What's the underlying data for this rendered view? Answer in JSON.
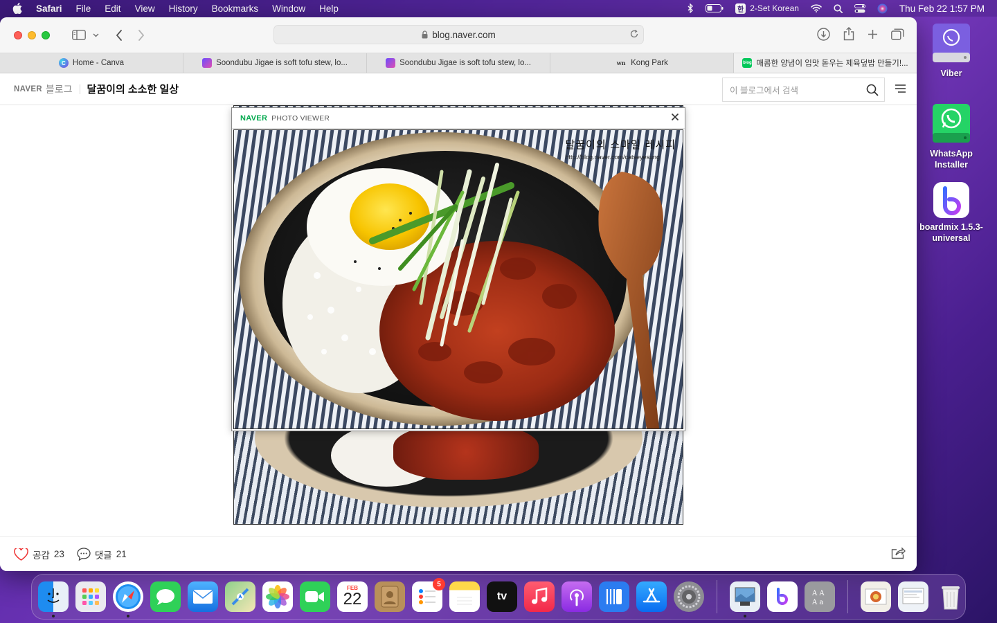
{
  "menubar": {
    "app_name": "Safari",
    "menus": [
      "File",
      "Edit",
      "View",
      "History",
      "Bookmarks",
      "Window",
      "Help"
    ],
    "input_source": "2-Set Korean",
    "input_glyph": "한",
    "datetime": "Thu Feb 22  1:57 PM"
  },
  "browser": {
    "url": "blog.naver.com",
    "tabs": [
      {
        "title": "Home - Canva",
        "icon": "canva-icon"
      },
      {
        "title": "Soondubu Jigae is soft tofu stew, lo...",
        "icon": "soondubu-site-icon"
      },
      {
        "title": "Soondubu Jigae is soft tofu stew, lo...",
        "icon": "soondubu-site-icon"
      },
      {
        "title": "Kong Park",
        "icon": "wn-site-icon",
        "glyph": "wn"
      },
      {
        "title": "매콤한 양념이 입맛 돋우는 제육덮밥 만들기!...",
        "icon": "naver-blog-icon",
        "glyph": "blog"
      }
    ]
  },
  "blog": {
    "naver_logo": "NAVER",
    "blog_word": "블로그",
    "title": "달꿈이의 소소한 일상",
    "search_placeholder": "이 블로그에서 검색",
    "like_label": "공감",
    "like_count": "23",
    "comment_label": "댓글",
    "comment_count": "21"
  },
  "viewer": {
    "brand": "NAVER",
    "title": "PHOTO VIEWER",
    "watermark_title": "달꿈이의 스마일 레시피",
    "watermark_url": "http://blog.naver.com/catseyesung"
  },
  "desktop_icons": [
    {
      "label": "Viber"
    },
    {
      "label": "WhatsApp Installer"
    },
    {
      "label": "boardmix 1.5.3-universal"
    }
  ],
  "dock": {
    "calendar_month": "FEB",
    "calendar_day": "22",
    "reminders_badge": "5",
    "tv_label": "tv"
  },
  "colors": {
    "naver_green": "#03a94e",
    "safari_red": "#fe5f57",
    "safari_yellow": "#febc2e",
    "safari_green": "#28c840",
    "desktop_purple": "#5b2aa8"
  }
}
